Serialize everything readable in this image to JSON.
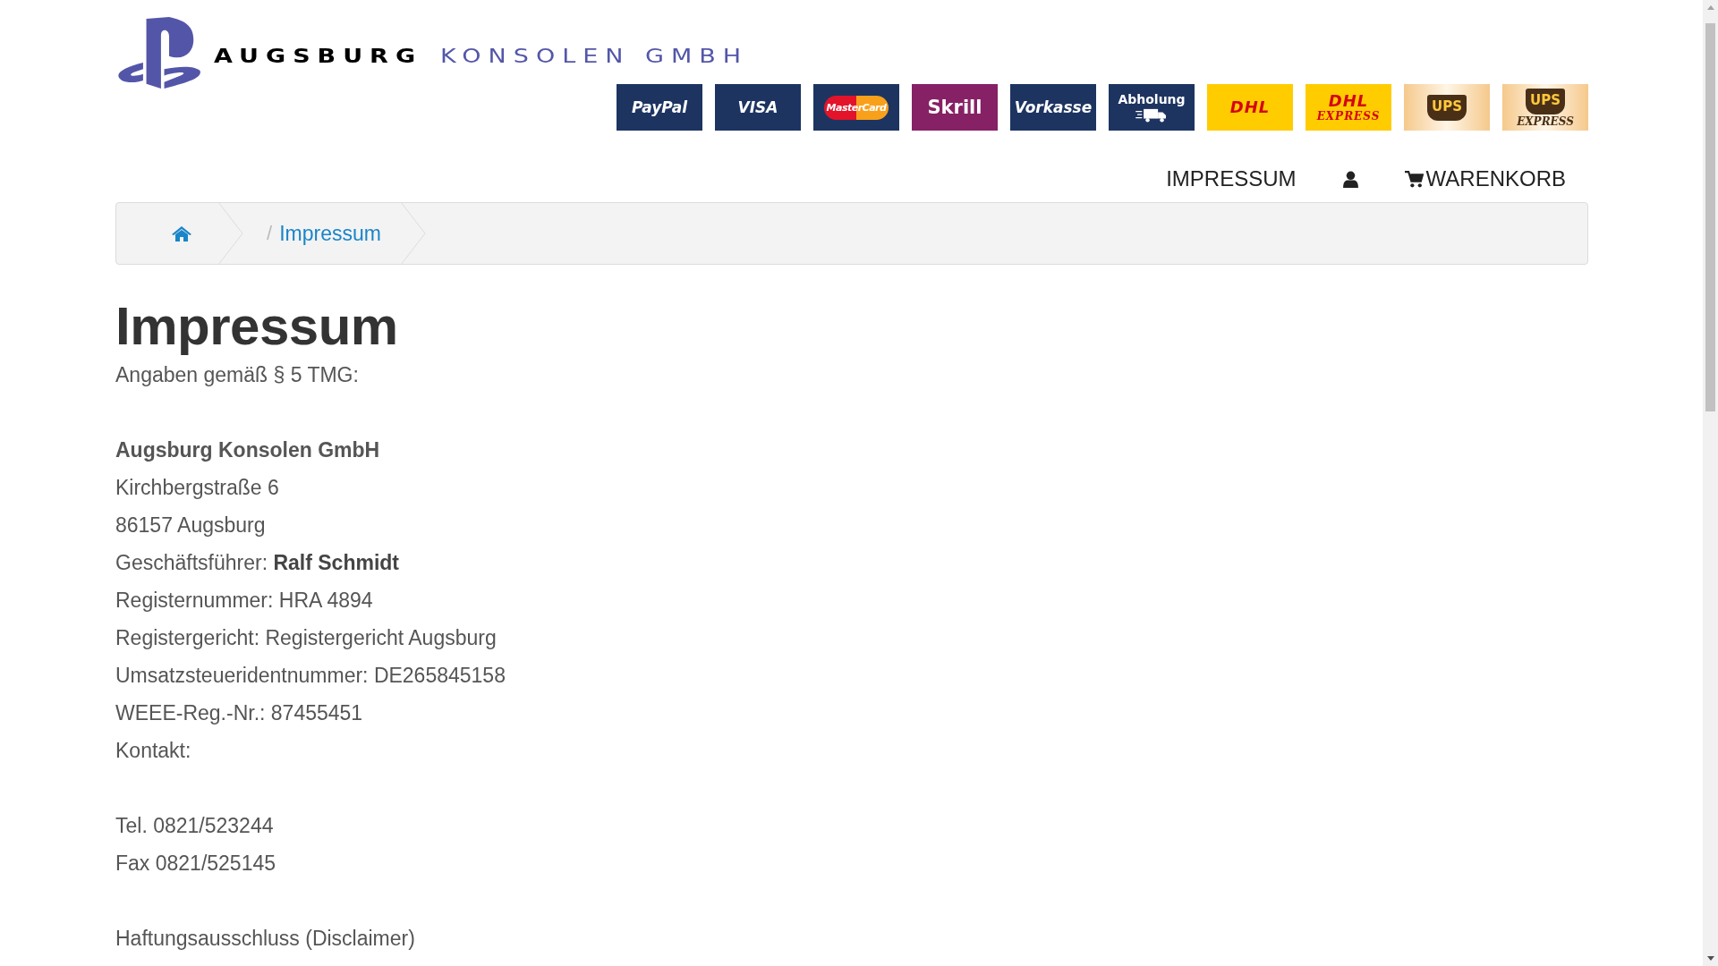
{
  "logo": {
    "word_1": "AUGSBURG",
    "word_2": "KONSOLEN GMBH"
  },
  "badges": [
    {
      "kind": "paypal",
      "label": "PayPal"
    },
    {
      "kind": "dark",
      "label": "VISA"
    },
    {
      "kind": "mastercard",
      "label": "MasterCard"
    },
    {
      "kind": "skrill",
      "label": "Skrill"
    },
    {
      "kind": "dark",
      "label": "Vorkasse"
    },
    {
      "kind": "pickup",
      "label": "Abholung"
    },
    {
      "kind": "dhl",
      "label": "DHL"
    },
    {
      "kind": "dhl",
      "label": "DHL",
      "sub": "EXPRESS"
    },
    {
      "kind": "ups",
      "label": "UPS"
    },
    {
      "kind": "ups",
      "label": "UPS",
      "sub": "EXPRESS"
    }
  ],
  "nav": [
    {
      "kind": "link",
      "label": "IMPRESSUM"
    },
    {
      "kind": "account"
    },
    {
      "kind": "cart",
      "label": "WARENKORB"
    }
  ],
  "breadcrumb": [
    {
      "kind": "home"
    },
    {
      "kind": "link",
      "separator": "/",
      "label": "Impressum"
    }
  ],
  "heading": "Impressum",
  "lines": [
    {
      "kind": "text",
      "text": "Angaben gemäß § 5 TMG:",
      "bold": false
    },
    {
      "kind": "blank"
    },
    {
      "kind": "text",
      "text": "Augsburg Konsolen GmbH",
      "bold": true
    },
    {
      "kind": "text",
      "text": "Kirchbergstraße 6",
      "bold": false
    },
    {
      "kind": "text",
      "text": "86157 Augsburg",
      "bold": false
    },
    {
      "kind": "text",
      "text": "Geschäftsführer: **Ralf Schmidt**",
      "bold": false
    },
    {
      "kind": "text",
      "text": "Registernummer: HRA 4894",
      "bold": false
    },
    {
      "kind": "text",
      "text": "Registergericht: Registergericht Augsburg",
      "bold": false
    },
    {
      "kind": "text",
      "text": "Umsatzsteueridentnummer: DE265845158",
      "bold": false
    },
    {
      "kind": "text",
      "text": "WEEE-Reg.-Nr.: 87455451",
      "bold": false
    },
    {
      "kind": "text",
      "text": "Kontakt:",
      "bold": false
    },
    {
      "kind": "blank"
    },
    {
      "kind": "text",
      "text": "Tel. 0821/523244",
      "bold": false
    },
    {
      "kind": "text",
      "text": "Fax 0821/525145",
      "bold": false
    },
    {
      "kind": "blank"
    },
    {
      "kind": "text",
      "text": "Haftungsausschluss (Disclaimer)",
      "bold": false
    }
  ]
}
